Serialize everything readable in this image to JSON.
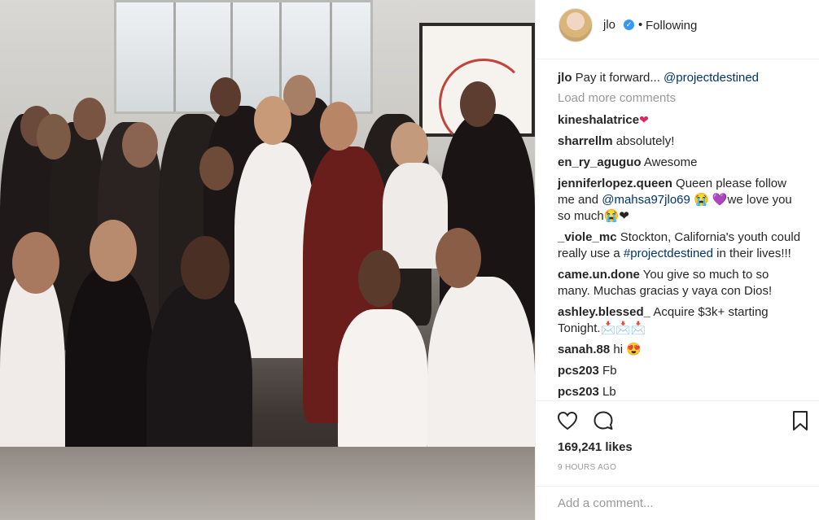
{
  "post": {
    "username": "jlo",
    "verified_mark": "✓",
    "separator": "•",
    "follow_status": "Following",
    "caption": {
      "user": "jlo",
      "text": "Pay it forward...",
      "mention": "@projectdestined"
    },
    "load_more": "Load more comments",
    "comments": [
      {
        "user": "kineshalatrice",
        "text": "",
        "emoji": "❤"
      },
      {
        "user": "sharrellm",
        "text": "absolutely!"
      },
      {
        "user": "en_ry_aguguo",
        "text": "Awesome"
      },
      {
        "user": "jenniferlopez.queen",
        "text": "Queen please follow me and",
        "mention": "@mahsa97jlo69",
        "text2": "😭 💜we love you so much😭❤"
      },
      {
        "user": "_viole_mc",
        "text": "Stockton, California's youth could really use a",
        "mention": "#projectdestined",
        "text2": "in their lives!!!"
      },
      {
        "user": "came.un.done",
        "text": "You give so much to so many. Muchas gracias y vaya con Dios!"
      },
      {
        "user": "ashley.blessed_",
        "text": "Acquire $3k+ starting Tonight.📩📩📩"
      },
      {
        "user": "sanah.88",
        "text": "hi 😍"
      },
      {
        "user": "pcs203",
        "text": "Fb"
      },
      {
        "user": "pcs203",
        "text": "Lb"
      }
    ],
    "likes": "169,241 likes",
    "time_ago": "9 HOURS AGO",
    "add_comment_placeholder": "Add a comment..."
  },
  "icons": {
    "like": "heart-icon",
    "comment": "comment-bubble-icon",
    "save": "bookmark-icon"
  },
  "colors": {
    "text": "#262626",
    "muted": "#999999",
    "link": "#003569",
    "verified": "#3897f0",
    "border": "#efefef"
  }
}
